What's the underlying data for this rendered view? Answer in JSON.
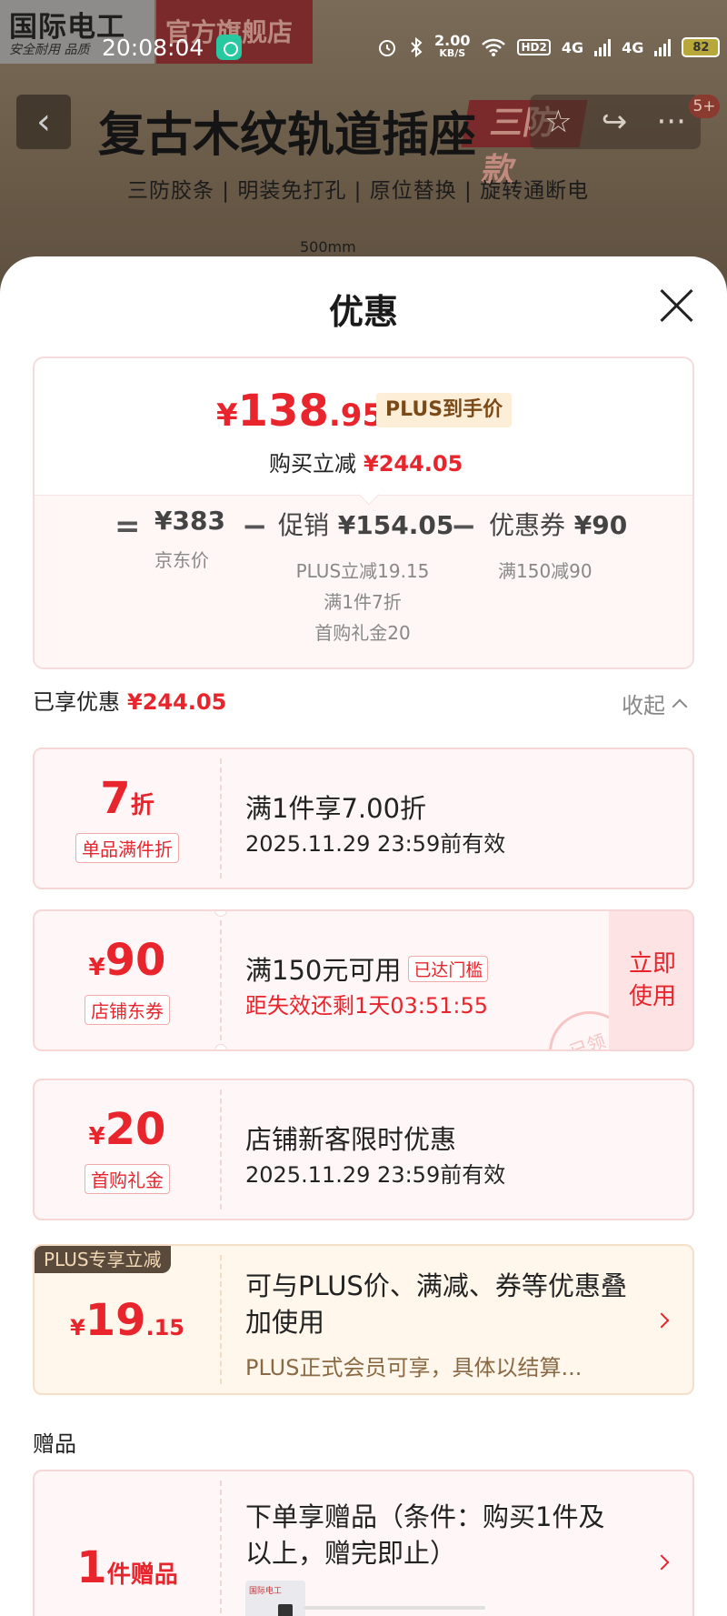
{
  "background": {
    "brand": {
      "name": "国际电工",
      "slogan": "安全耐用 品质"
    },
    "store_name": "官方旗舰店",
    "product_title": "复古木纹轨道插座",
    "title_badge": "三防款",
    "features": "三防胶条 | 明装免打孔 | 原位替换 | 旋转通断电",
    "size_label": "500mm",
    "nav_badge": "5+",
    "icons": [
      "back-icon",
      "star-icon",
      "share-icon",
      "more-icon"
    ]
  },
  "status_bar": {
    "time": "20:08:04",
    "net_speed": "2.00",
    "net_unit": "KB/S",
    "hd_label": "HD2",
    "sim1": "4G",
    "sim2": "4G",
    "battery": "82"
  },
  "sheet": {
    "title": "优惠",
    "close_icon": "close-icon",
    "price_card": {
      "currency": "¥",
      "price_int": "138",
      "price_dec": ".95",
      "plus_tag": "PLUS到手价",
      "reduce_label": "购买立减",
      "reduce_amount": "¥244.05",
      "equals": "=",
      "minus": "−",
      "jd_price": {
        "value": "¥383",
        "label": "京东价"
      },
      "promotion": {
        "label": "促销",
        "value": "¥154.05",
        "details": [
          "PLUS立减19.15",
          "满1件7折",
          "首购礼金20"
        ]
      },
      "coupon": {
        "label": "优惠券",
        "value": "¥90",
        "detail": "满150减90"
      }
    },
    "enjoyed": {
      "label": "已享优惠",
      "amount": "¥244.05"
    },
    "collapse_label": "收起",
    "coupons": [
      {
        "value": "7",
        "unit": "折",
        "tag": "单品满件折",
        "title": "满1件享7.00折",
        "subtitle": "2025.11.29 23:59前有效"
      },
      {
        "prefix": "¥",
        "value": "90",
        "tag": "店铺东券",
        "title": "满150元可用",
        "threshold": "已达门槛",
        "subtitle": "距失效还剩1天03:51:55",
        "action": [
          "立即",
          "使用"
        ],
        "stamp": "已领"
      },
      {
        "prefix": "¥",
        "value": "20",
        "tag": "首购礼金",
        "title": "店铺新客限时优惠",
        "subtitle": "2025.11.29 23:59前有效"
      }
    ],
    "plus": {
      "badge": "PLUS专享立减",
      "prefix": "¥",
      "value_int": "19",
      "value_dec": ".15",
      "title": "可与PLUS价、满减、券等优惠叠加使用",
      "subtitle": "PLUS正式会员可享，具体以结算..."
    },
    "gift": {
      "heading": "赠品",
      "count": "1",
      "unit": "件赠品",
      "title": "下单享赠品（条件：购买1件及以上，赠完即止）",
      "thumb_label": "国际电工"
    }
  },
  "colors": {
    "accent_red": "#e8252c",
    "plus_gold": "#7a4a18"
  }
}
